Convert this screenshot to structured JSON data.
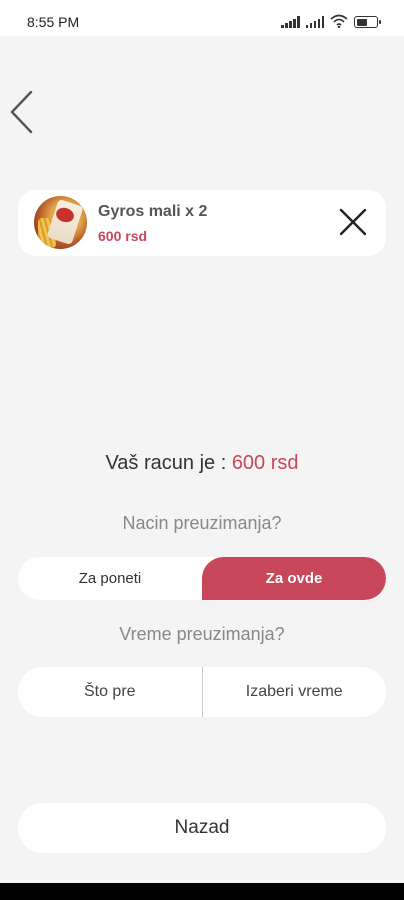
{
  "status_bar": {
    "time": "8:55 PM"
  },
  "order_item": {
    "name": "Gyros mali x 2",
    "price": "600 rsd"
  },
  "summary": {
    "total_prefix": "Vaš racun je : ",
    "total_amount": "600 rsd"
  },
  "pickup_method": {
    "question": "Nacin preuzimanja?",
    "options": [
      "Za poneti",
      "Za ovde"
    ],
    "selected": "Za ovde"
  },
  "pickup_time": {
    "question": "Vreme preuzimanja?",
    "options": [
      "Što pre",
      "Izaberi vreme"
    ]
  },
  "footer": {
    "back_label": "Nazad"
  },
  "colors": {
    "accent": "#c8475a",
    "background": "#f4f4f4",
    "card": "#ffffff"
  }
}
